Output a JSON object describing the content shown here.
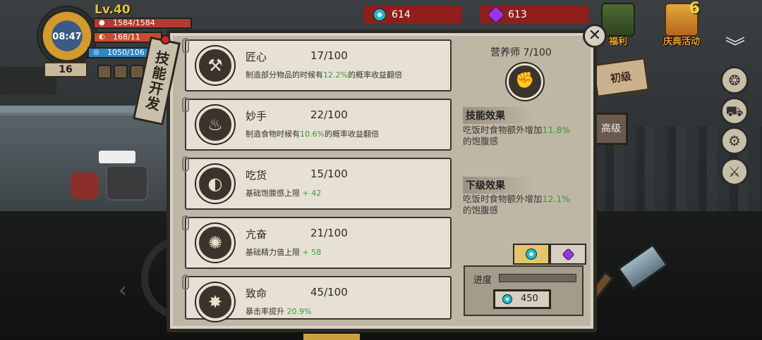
{
  "hud": {
    "level": "Lv.40",
    "time": "08:47",
    "hp": "1584/1584",
    "food": "168/11",
    "energy": "1050/106",
    "day": "16"
  },
  "currency": {
    "coins": "614",
    "gems": "613"
  },
  "right_menu": {
    "welfare_label": "福利",
    "celebrate_label": "庆典活动",
    "celebrate_badge": "6"
  },
  "panel": {
    "title": "技能开发",
    "close": "✕",
    "tab_basic": "初级",
    "tab_advanced": "高级"
  },
  "skills": [
    {
      "name": "匠心",
      "level": "17/100",
      "desc_pre": "制造部分物品的时候有",
      "desc_hl": "12.2%",
      "desc_post": "的概率收益翻倍",
      "icon": "⚒"
    },
    {
      "name": "妙手",
      "level": "22/100",
      "desc_pre": "制造食物时候有",
      "desc_hl": "10.6%",
      "desc_post": "的概率收益翻倍",
      "icon": "♨"
    },
    {
      "name": "吃货",
      "level": "15/100",
      "desc_pre": "基础饱腹感上限",
      "desc_hl": " + 42",
      "desc_post": "",
      "icon": "◐"
    },
    {
      "name": "亢奋",
      "level": "21/100",
      "desc_pre": "基础精力值上限",
      "desc_hl": " + 58",
      "desc_post": "",
      "icon": "✺"
    },
    {
      "name": "致命",
      "level": "45/100",
      "desc_pre": "暴击率提升",
      "desc_hl": " 20.9%",
      "desc_post": "",
      "icon": "✸"
    }
  ],
  "info": {
    "title": "营养师  7/100",
    "effect_head": "技能效果",
    "effect_pre": "吃饭时食物额外增加",
    "effect_hl": "11.8%",
    "effect_post": "的饱腹感",
    "next_head": "下级效果",
    "next_pre": "吃饭时食物额外增加",
    "next_hl": "12.1%",
    "next_post": "的饱腹感"
  },
  "pay": {
    "progress_label": "进度",
    "progress": 0,
    "cost": "450"
  },
  "colors": {
    "highlight": "#3b9a3b",
    "panel": "#d8d2c4",
    "currency_bg": "#8e1f1b"
  }
}
